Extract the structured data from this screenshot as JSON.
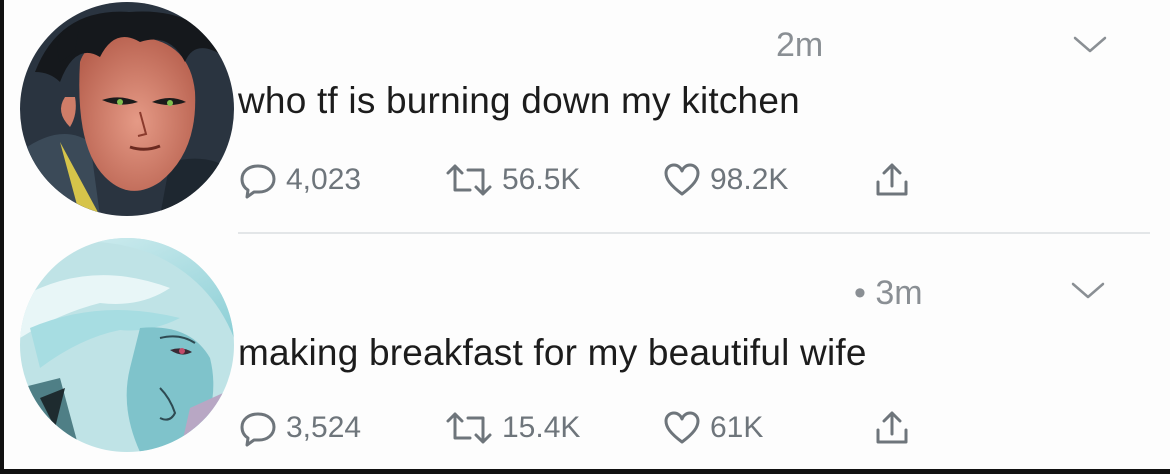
{
  "tweets": [
    {
      "time": "2m",
      "text": "who tf is burning down my kitchen",
      "replies": "4,023",
      "retweets": "56.5K",
      "likes": "98.2K",
      "icons": [
        "reply-icon",
        "retweet-icon",
        "like-icon",
        "share-icon",
        "caret-down-icon"
      ]
    },
    {
      "time": "• 3m",
      "text": "making breakfast for my beautiful wife",
      "replies": "3,524",
      "retweets": "15.4K",
      "likes": "61K",
      "icons": [
        "reply-icon",
        "retweet-icon",
        "like-icon",
        "share-icon",
        "caret-down-icon"
      ]
    }
  ],
  "colors": {
    "text": "#1c1c1c",
    "meta": "#8a8f94",
    "icon": "#6e757b",
    "divider": "#e3e6e8"
  }
}
